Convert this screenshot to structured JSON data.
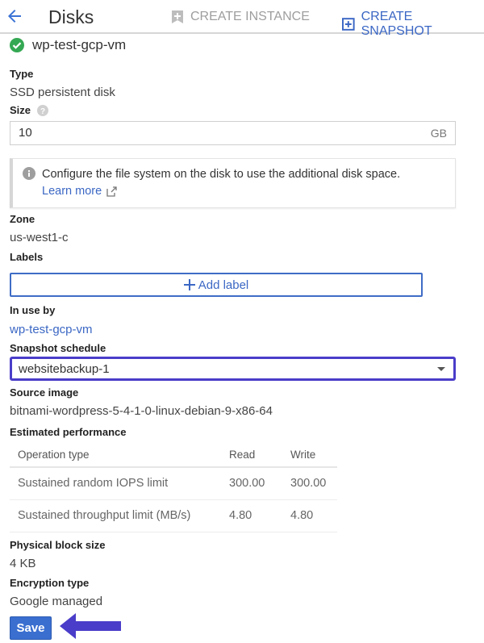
{
  "header": {
    "back_icon": "arrow-left-icon",
    "title": "Disks",
    "create_instance_label": "CREATE INSTANCE",
    "create_instance_icon": "bookmark-plus-icon",
    "create_snapshot_label": "CREATE SNAPSHOT",
    "create_snapshot_icon": "snapshot-plus-icon"
  },
  "disk": {
    "status_icon": "check-circle-icon",
    "status_color": "#34a853",
    "name": "wp-test-gcp-vm"
  },
  "fields": {
    "type_label": "Type",
    "type_value": "SSD persistent disk",
    "size_label": "Size",
    "size_help_icon": "help-circle-icon",
    "size_value": "10",
    "size_unit": "GB",
    "info_message": "Configure the file system on the disk to use the additional disk space.",
    "info_link": "Learn more",
    "zone_label": "Zone",
    "zone_value": "us-west1-c",
    "labels_label": "Labels",
    "add_label_button": "Add label",
    "in_use_label": "In use by",
    "in_use_value": "wp-test-gcp-vm",
    "snapshot_label": "Snapshot schedule",
    "snapshot_value": "websitebackup-1",
    "source_image_label": "Source image",
    "source_image_value": "bitnami-wordpress-5-4-1-0-linux-debian-9-x86-64",
    "perf_label": "Estimated performance",
    "block_size_label": "Physical block size",
    "block_size_value": "4 KB",
    "encryption_label": "Encryption type",
    "encryption_value": "Google managed"
  },
  "performance": {
    "headers": [
      "Operation type",
      "Read",
      "Write"
    ],
    "rows": [
      [
        "Sustained random IOPS limit",
        "300.00",
        "300.00"
      ],
      [
        "Sustained throughput limit (MB/s)",
        "4.80",
        "4.80"
      ]
    ]
  },
  "actions": {
    "save_label": "Save"
  },
  "colors": {
    "accent": "#3b67c4",
    "highlight": "#4a3dc9",
    "save_bg": "#3a6fd0"
  }
}
